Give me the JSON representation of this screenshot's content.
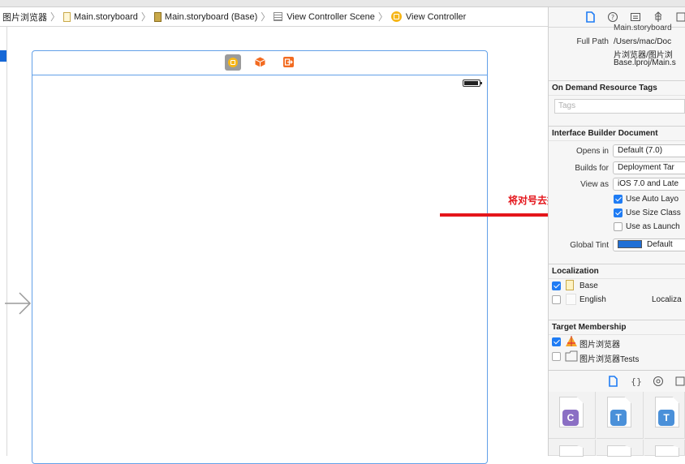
{
  "breadcrumb": {
    "items": [
      {
        "label": "图片浏览器",
        "icon": "none"
      },
      {
        "label": "Main.storyboard",
        "icon": "storyboard-file-icon"
      },
      {
        "label": "Main.storyboard (Base)",
        "icon": "storyboard-base-icon"
      },
      {
        "label": "View Controller Scene",
        "icon": "scene-icon"
      },
      {
        "label": "View Controller",
        "icon": "view-controller-icon"
      }
    ],
    "separator": "〉"
  },
  "annotation": {
    "text": "将对号去掉",
    "color": "#e4151b"
  },
  "inspector": {
    "identity": {
      "top_value": "Main.storyboard",
      "full_path_label": "Full Path",
      "full_path_lines": [
        "/Users/mac/Doc",
        "片浏览器/图片浏",
        "Base.lproj/Main.s"
      ]
    },
    "on_demand": {
      "header": "On Demand Resource Tags",
      "tags_placeholder": "Tags"
    },
    "ib_document": {
      "header": "Interface Builder Document",
      "opens_in_label": "Opens in",
      "opens_in_value": "Default (7.0)",
      "builds_for_label": "Builds for",
      "builds_for_value": "Deployment Tar",
      "view_as_label": "View as",
      "view_as_value": "iOS 7.0 and Late",
      "checkboxes": [
        {
          "label": "Use Auto Layo",
          "checked": true
        },
        {
          "label": "Use Size Class",
          "checked": true
        },
        {
          "label": "Use as Launch",
          "checked": false
        }
      ],
      "global_tint_label": "Global Tint",
      "global_tint_value": "Default",
      "global_tint_color": "#1f6fd6"
    },
    "localization": {
      "header": "Localization",
      "rows": [
        {
          "label": "Base",
          "checked": true,
          "extra": ""
        },
        {
          "label": "English",
          "checked": false,
          "extra": "Localiza"
        }
      ]
    },
    "target_membership": {
      "header": "Target Membership",
      "rows": [
        {
          "label": "图片浏览器",
          "checked": true,
          "icon": "app-target-icon"
        },
        {
          "label": "图片浏览器Tests",
          "checked": false,
          "icon": "test-target-icon"
        }
      ]
    }
  },
  "library": {
    "cells": [
      {
        "badge": "C",
        "color": "#8b6fc4"
      },
      {
        "badge": "T",
        "color": "#4a90d9"
      },
      {
        "badge": "T",
        "color": "#4a90d9"
      }
    ]
  },
  "colors": {
    "accent": "#1f7cf4",
    "scene_border": "#62a0e8",
    "view_controller_icon": "#f6b618",
    "exit_icon": "#f26b21"
  }
}
